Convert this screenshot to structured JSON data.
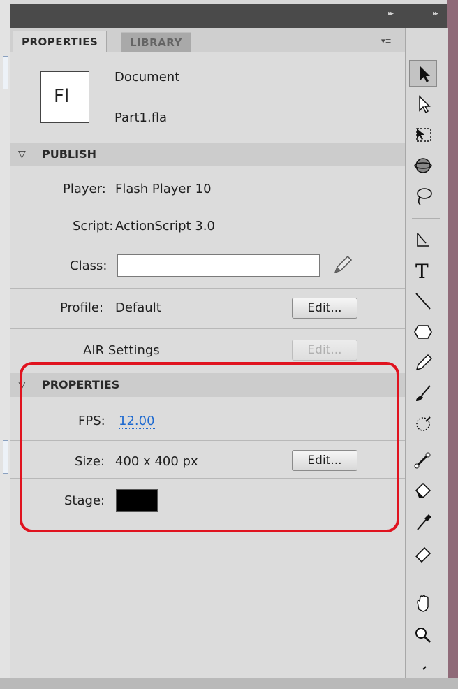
{
  "tabs": {
    "properties": "PROPERTIES",
    "library": "LIBRARY"
  },
  "header_controls": {
    "collapse_left": "▸▸",
    "collapse_right": "▸▸",
    "panel_menu": "▾≡"
  },
  "document": {
    "icon_text": "Fl",
    "type_label": "Document",
    "file_name": "Part1.fla"
  },
  "publish": {
    "title": "PUBLISH",
    "player_label": "Player:",
    "player_value": "Flash Player 10",
    "script_label": "Script:",
    "script_value": "ActionScript 3.0",
    "class_label": "Class:",
    "class_value": "",
    "profile_label": "Profile:",
    "profile_value": "Default",
    "profile_edit": "Edit...",
    "air_settings_label": "AIR Settings",
    "air_edit": "Edit..."
  },
  "properties": {
    "title": "PROPERTIES",
    "fps_label": "FPS:",
    "fps_value": "12.00",
    "size_label": "Size:",
    "size_value": "400 x 400 px",
    "size_edit": "Edit...",
    "stage_label": "Stage:",
    "stage_color": "#000000"
  },
  "highlight_color": "#e0131f",
  "toolbar": {
    "tools": [
      "selection-tool",
      "subselection-tool",
      "free-transform-tool",
      "3d-rotation-tool",
      "lasso-tool",
      "pen-tool",
      "text-tool",
      "line-tool",
      "rectangle-tool",
      "pencil-tool",
      "brush-tool",
      "deco-tool",
      "bone-tool",
      "paint-bucket-tool",
      "eyedropper-tool",
      "eraser-tool",
      "hand-tool",
      "zoom-tool"
    ],
    "text_tool_glyph": "T"
  }
}
